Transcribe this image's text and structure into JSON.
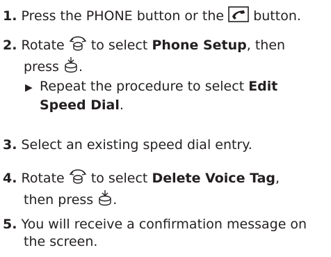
{
  "steps": [
    {
      "number": "1.",
      "text_a": "Press the PHONE button or the",
      "icon": "phone-pickup-icon",
      "text_b": "button."
    },
    {
      "number": "2.",
      "text_a": "Rotate",
      "icon1": "selector-knob-rotate-icon",
      "text_b": "to select",
      "bold_a": "Phone Setup",
      "text_c": ", then",
      "text_d": "press",
      "icon2": "selector-knob-press-icon",
      "text_e": ".",
      "sub": {
        "icon": "right-triangle-icon",
        "text_a": "Repeat the procedure to select",
        "bold_a": "Edit",
        "bold_b": "Speed Dial",
        "text_b": "."
      }
    },
    {
      "number": "3.",
      "text_a": "Select an existing speed dial entry."
    },
    {
      "number": "4.",
      "text_a": "Rotate",
      "icon1": "selector-knob-rotate-icon",
      "text_b": "to select",
      "bold_a": "Delete Voice Tag",
      "text_c": ",",
      "text_d": "then press",
      "icon2": "selector-knob-press-icon",
      "text_e": "."
    },
    {
      "number": "5.",
      "text_a": "You will receive a confirmation message on",
      "text_b": "the screen."
    }
  ]
}
